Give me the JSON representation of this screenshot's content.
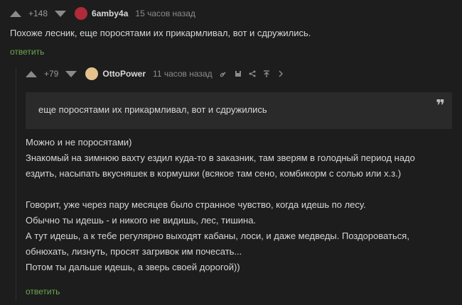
{
  "comment1": {
    "rating": "+148",
    "author": "6amby4a",
    "time": "15 часов назад",
    "text": "Похоже лесник, еще поросятами их прикармливал, вот и сдружились.",
    "reply_label": "ответить"
  },
  "comment2": {
    "rating": "+79",
    "author": "OttoPower",
    "time": "11 часов назад",
    "quote": "еще поросятами их прикармливал, вот и сдружились",
    "lines": [
      "Можно и не поросятами)",
      "Знакомый на зимнюю вахту ездил куда-то в заказник, там зверям в голодный период надо",
      "ездить, насыпать вкусняшек в кормушки (всякое там сено, комбикорм с солью или х.з.)",
      "",
      "Говорит, уже через пару месяцев было странное чувство, когда идешь по лесу.",
      "Обычно ты идешь - и никого не видишь, лес, тишина.",
      "А тут идешь, а к тебе регулярно выходят кабаны, лоси, и даже медведы. Поздороваться,",
      "обнюхать, лизнуть, просят загривок им почесать...",
      "Потом ты дальше идешь, а зверь своей дорогой))"
    ],
    "reply_label": "ответить"
  },
  "icons": [
    "vote-up",
    "vote-down",
    "link",
    "save",
    "share",
    "collapse",
    "more"
  ],
  "colors": {
    "background": "#1d1d1d",
    "text": "#d7d7d7",
    "reply": "#6aa84f",
    "quote_bg": "#2a2a2a"
  }
}
